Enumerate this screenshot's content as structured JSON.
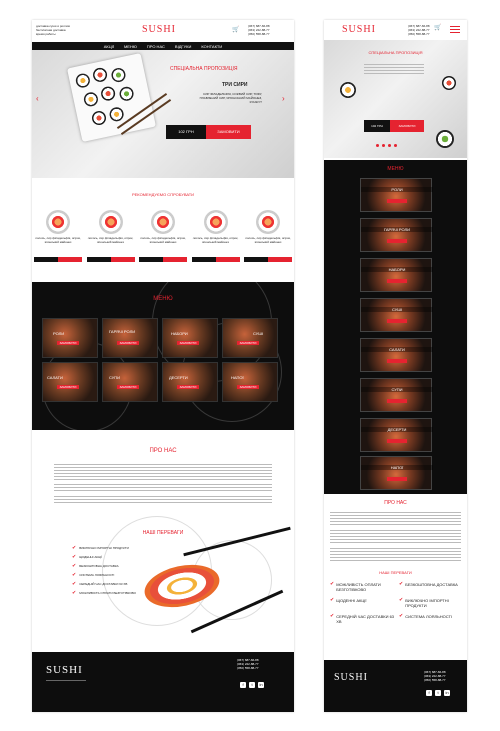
{
  "desktop": {
    "header": {
      "left_info": [
        "доставка суши и роллов",
        "бесплатная доставка",
        "время работы"
      ],
      "brand": "SUSHI",
      "phones": [
        "(067) 687-66-88",
        "(063) 222-88-77",
        "(050) 558-88-77"
      ]
    },
    "nav": [
      "АКЦІЇ",
      "МЕНЮ",
      "ПРО НАС",
      "ВІДГУКИ",
      "КОНТАКТИ"
    ],
    "hero": {
      "special": "СПЕЦІАЛЬНА ПРОПОЗИЦІЯ",
      "title": "ТРИ СИРИ",
      "desc": "СИР ФІЛАДЕЛЬФІЯ, СОЄВИЙ СИР, ТОФУ, ПЛАВЛЕНИЙ СИР, ЯПОНСЬКИЙ МАЙОНЕЗ, КУНЖУТ",
      "price": "102 ГРН",
      "order": "ЗАМОВИТИ"
    },
    "recommend": {
      "title": "РЕКОМЕНДУЄМО СПРОБУВАТИ",
      "cards": [
        {
          "desc": "лосось, сир філадельфія, огірок, японський майонез"
        },
        {
          "desc": "лосось, сир філадельфія, огірок, японський майонез"
        },
        {
          "desc": "лосось, сир філадельфія, огірок, японський майонез"
        },
        {
          "desc": "лосось, сир філадельфія, огірок, японський майонез"
        },
        {
          "desc": "лосось, сир філадельфія, огірок, японський майонез"
        }
      ]
    },
    "menu": {
      "title": "МЕНЮ",
      "items": [
        "РОЛИ",
        "ГАРЯЧІ РОЛИ",
        "НАБОРИ",
        "СУШІ",
        "САЛАТИ",
        "СУПИ",
        "ДЕСЕРТИ",
        "НАПОЇ"
      ],
      "btn": "ЗАМОВИТИ"
    },
    "about": {
      "title": "ПРО НАС"
    },
    "benefits": {
      "title": "НАШІ ПЕРЕВАГИ",
      "items": [
        "ВИКЛЮЧНО ІМПОРТНІ ПРОДУКТИ",
        "ЩОДЕННІ АКЦІЇ",
        "БЕЗКОШТОВНА ДОСТАВКА",
        "СИСТЕМА ЛОЯЛЬНОСТІ",
        "СЕРЕДНІЙ ЧАС ДОСТАВКИ 63 ХВ",
        "МОЖЛИВІСТЬ ОПЛАТИ БЕЗГОТІВКОВО"
      ]
    },
    "footer": {
      "brand": "SUSHI",
      "phones": [
        "(067) 687-66-88",
        "(063) 222-88-77",
        "(050) 558-88-77"
      ],
      "social": [
        "f",
        "t",
        "in"
      ]
    }
  },
  "mobile": {
    "brand": "SUSHI",
    "phones": [
      "(067) 687-66-88",
      "(063) 222-88-77",
      "(050) 558-88-77"
    ],
    "hero": {
      "special": "СПЕЦІАЛЬНА ПРОПОЗИЦІЯ",
      "price": "102 ГРН",
      "order": "ЗАМОВИТИ"
    },
    "menu_title": "МЕНЮ",
    "menu": [
      "РОЛИ",
      "ГАРЯЧІ РОЛИ",
      "НАБОРИ",
      "СУШІ",
      "САЛАТИ",
      "СУПИ",
      "ДЕСЕРТИ",
      "НАПОЇ"
    ],
    "about_title": "ПРО НАС",
    "benefits_title": "НАШІ ПЕРЕВАГИ",
    "benefits": [
      "МОЖЛИВІСТЬ ОПЛАТИ БЕЗГОТІВКОВО",
      "БЕЗКОШТОВНА ДОСТАВКА",
      "ЩОДЕННІ АКЦІЇ",
      "ВИКЛЮЧНО ІМПОРТНІ ПРОДУКТИ",
      "СЕРЕДНІЙ ЧАС ДОСТАВКИ 63 ХВ",
      "СИСТЕМА ЛОЯЛЬНОСТІ"
    ],
    "footer": {
      "brand": "SUSHI",
      "phones": [
        "(067) 687-66-88",
        "(063) 222-88-77",
        "(050) 558-88-77"
      ]
    }
  },
  "colors": {
    "accent": "#e52330",
    "dark": "#111111"
  }
}
